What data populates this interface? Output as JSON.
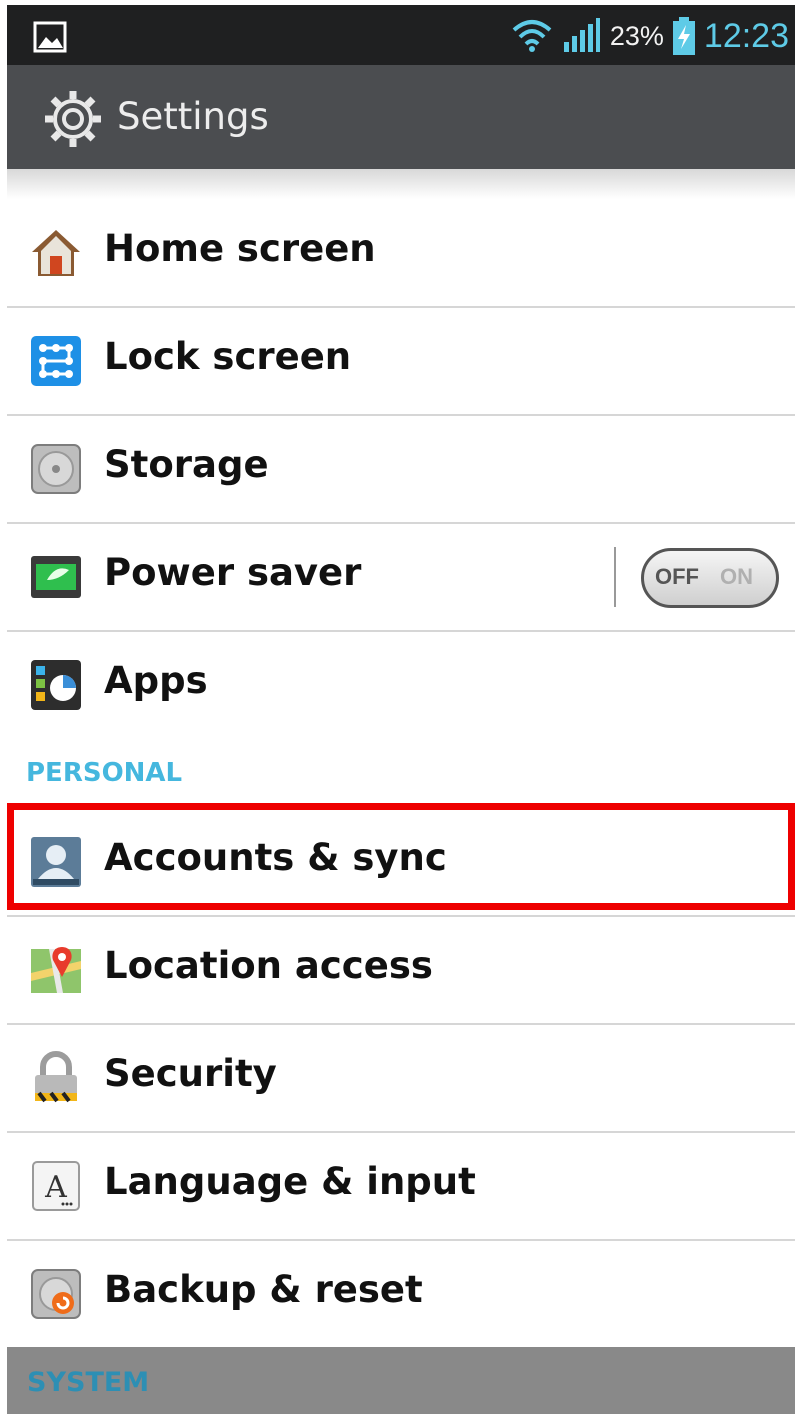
{
  "status_bar": {
    "battery_percent": "23%",
    "time": "12:23",
    "icons": [
      "image-icon",
      "wifi-icon",
      "signal-icon",
      "battery-charging-icon"
    ]
  },
  "header": {
    "title": "Settings",
    "icon": "gear-icon"
  },
  "rows_device": [
    {
      "label": "Home screen",
      "icon": "home-icon"
    },
    {
      "label": "Lock screen",
      "icon": "lock-screen-icon"
    },
    {
      "label": "Storage",
      "icon": "storage-icon"
    },
    {
      "label": "Power saver",
      "icon": "battery-icon"
    },
    {
      "label": "Apps",
      "icon": "apps-icon"
    }
  ],
  "power_saver_toggle": {
    "off_label": "OFF",
    "on_label": "ON",
    "state": "off"
  },
  "sections": {
    "personal": "PERSONAL",
    "system": "SYSTEM"
  },
  "rows_personal": [
    {
      "label": "Accounts & sync",
      "icon": "accounts-icon"
    },
    {
      "label": "Location access",
      "icon": "location-icon"
    },
    {
      "label": "Security",
      "icon": "padlock-icon"
    },
    {
      "label": "Language & input",
      "icon": "language-icon"
    },
    {
      "label": "Backup & reset",
      "icon": "backup-icon"
    }
  ],
  "colors": {
    "accent": "#45b7de",
    "highlight": "#ee0000",
    "action_bar": "#4b4d50",
    "status_bar": "#1f2021"
  }
}
